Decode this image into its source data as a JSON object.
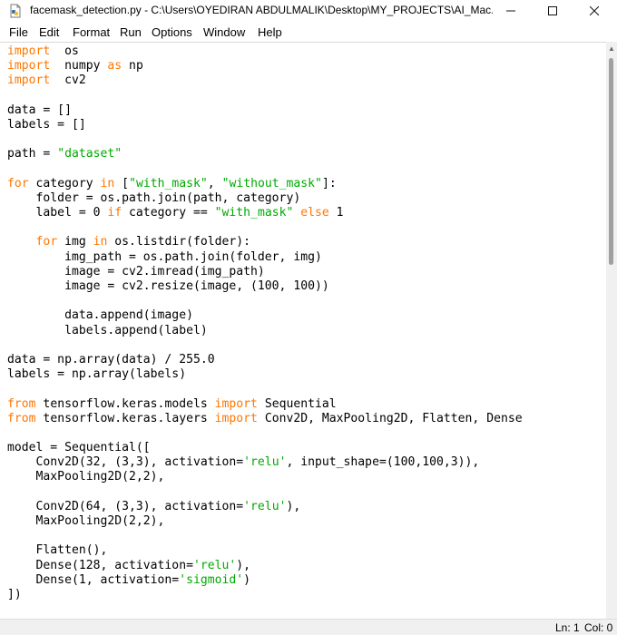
{
  "window": {
    "title": "facemask_detection.py - C:\\Users\\OYEDIRAN ABDULMALIK\\Desktop\\MY_PROJECTS\\AI_Mac...",
    "icon": "python-file-icon"
  },
  "menubar": {
    "items": [
      "File",
      "Edit",
      "Format",
      "Run",
      "Options",
      "Window",
      "Help"
    ]
  },
  "editor": {
    "lines": [
      [
        [
          "kw",
          "import"
        ],
        [
          "",
          "  os"
        ]
      ],
      [
        [
          "kw",
          "import"
        ],
        [
          "",
          "  numpy "
        ],
        [
          "kw",
          "as"
        ],
        [
          "",
          " np"
        ]
      ],
      [
        [
          "kw",
          "import"
        ],
        [
          "",
          "  cv2"
        ]
      ],
      [],
      [
        [
          "",
          "data = []"
        ]
      ],
      [
        [
          "",
          "labels = []"
        ]
      ],
      [],
      [
        [
          "",
          "path = "
        ],
        [
          "st",
          "\"dataset\""
        ]
      ],
      [],
      [
        [
          "kw",
          "for"
        ],
        [
          "",
          " category "
        ],
        [
          "kw",
          "in"
        ],
        [
          "",
          " ["
        ],
        [
          "st",
          "\"with_mask\""
        ],
        [
          "",
          ", "
        ],
        [
          "st",
          "\"without_mask\""
        ],
        [
          "",
          "]:"
        ]
      ],
      [
        [
          "",
          "    folder = os.path.join(path, category)"
        ]
      ],
      [
        [
          "",
          "    label = 0 "
        ],
        [
          "kw",
          "if"
        ],
        [
          "",
          " category == "
        ],
        [
          "st",
          "\"with_mask\""
        ],
        [
          "kw",
          " else"
        ],
        [
          "",
          " 1"
        ]
      ],
      [],
      [
        [
          "",
          "    "
        ],
        [
          "kw",
          "for"
        ],
        [
          "",
          " img "
        ],
        [
          "kw",
          "in"
        ],
        [
          "",
          " os.listdir(folder):"
        ]
      ],
      [
        [
          "",
          "        img_path = os.path.join(folder, img)"
        ]
      ],
      [
        [
          "",
          "        image = cv2.imread(img_path)"
        ]
      ],
      [
        [
          "",
          "        image = cv2.resize(image, (100, 100))"
        ]
      ],
      [],
      [
        [
          "",
          "        data.append(image)"
        ]
      ],
      [
        [
          "",
          "        labels.append(label)"
        ]
      ],
      [],
      [
        [
          "",
          "data = np.array(data) / 255.0"
        ]
      ],
      [
        [
          "",
          "labels = np.array(labels)"
        ]
      ],
      [],
      [
        [
          "kw",
          "from"
        ],
        [
          "",
          " tensorflow.keras.models "
        ],
        [
          "kw",
          "import"
        ],
        [
          "",
          " Sequential"
        ]
      ],
      [
        [
          "kw",
          "from"
        ],
        [
          "",
          " tensorflow.keras.layers "
        ],
        [
          "kw",
          "import"
        ],
        [
          "",
          " Conv2D, MaxPooling2D, Flatten, Dense"
        ]
      ],
      [],
      [
        [
          "",
          "model = Sequential(["
        ]
      ],
      [
        [
          "",
          "    Conv2D(32, (3,3), activation="
        ],
        [
          "st",
          "'relu'"
        ],
        [
          "",
          ", input_shape=(100,100,3)),"
        ]
      ],
      [
        [
          "",
          "    MaxPooling2D(2,2),"
        ]
      ],
      [],
      [
        [
          "",
          "    Conv2D(64, (3,3), activation="
        ],
        [
          "st",
          "'relu'"
        ],
        [
          "",
          "),"
        ]
      ],
      [
        [
          "",
          "    MaxPooling2D(2,2),"
        ]
      ],
      [],
      [
        [
          "",
          "    Flatten(),"
        ]
      ],
      [
        [
          "",
          "    Dense(128, activation="
        ],
        [
          "st",
          "'relu'"
        ],
        [
          "",
          "),"
        ]
      ],
      [
        [
          "",
          "    Dense(1, activation="
        ],
        [
          "st",
          "'sigmoid'"
        ],
        [
          "",
          ")"
        ]
      ],
      [
        [
          "",
          "])"
        ]
      ]
    ]
  },
  "statusbar": {
    "ln": "Ln: 1",
    "col": "Col: 0"
  }
}
